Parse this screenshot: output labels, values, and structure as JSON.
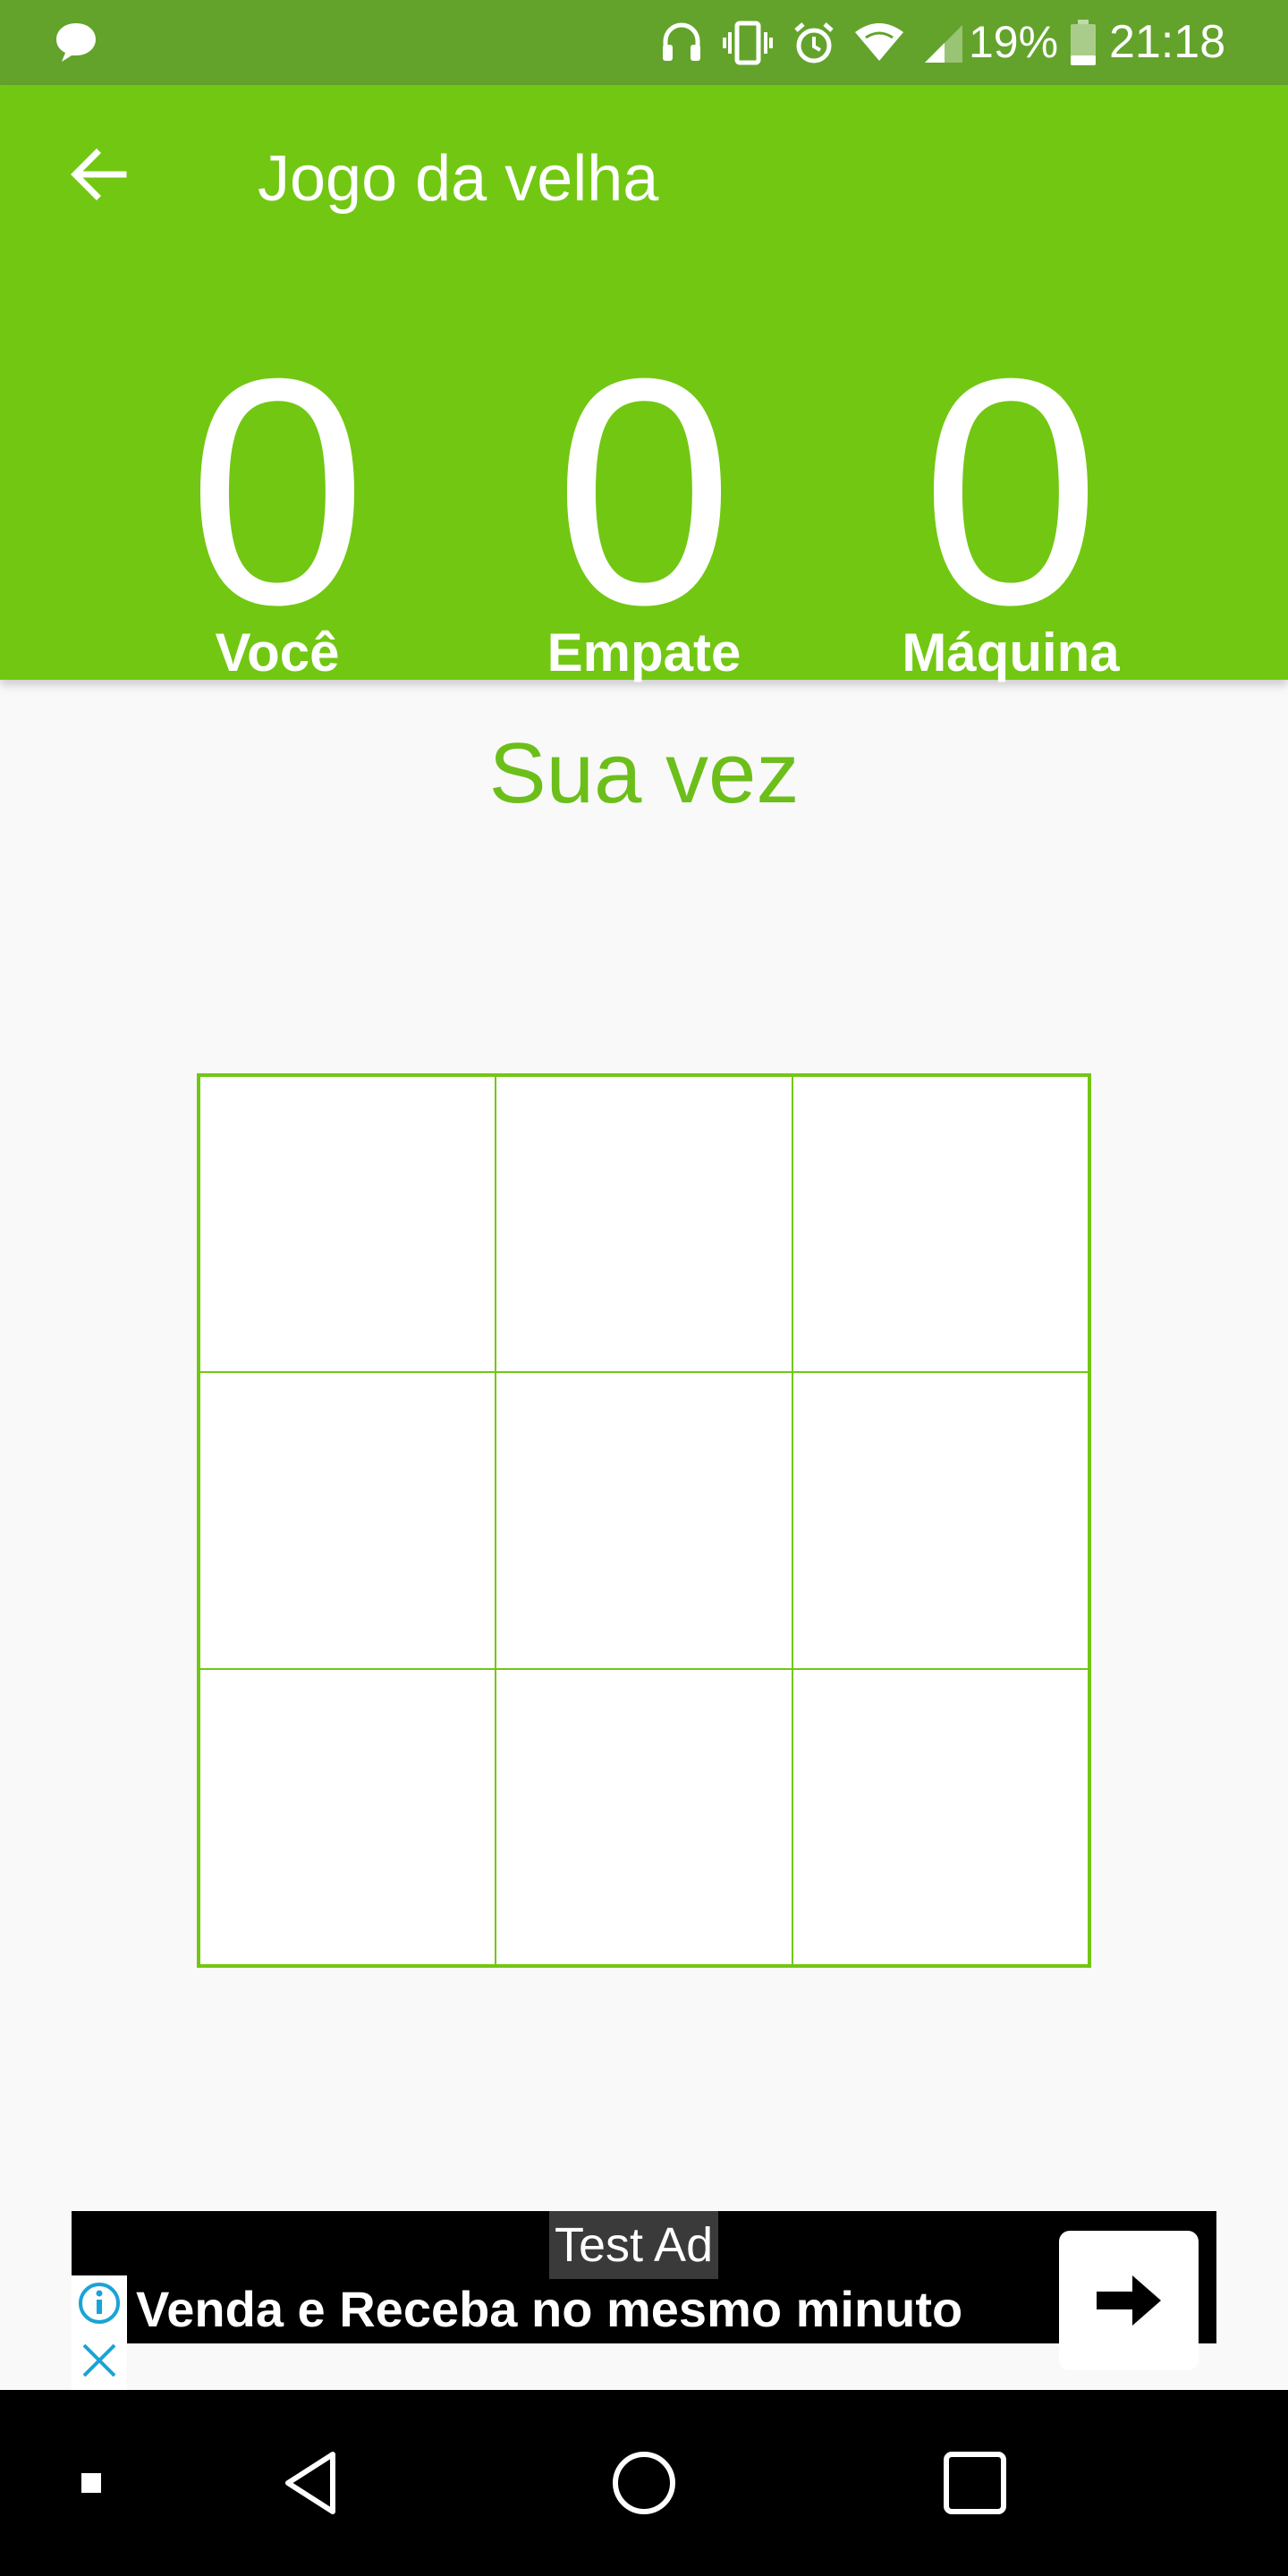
{
  "status_bar": {
    "battery_percent": "19%",
    "time": "21:18",
    "icons": [
      "chat-bubble-icon",
      "headset-icon",
      "vibrate-icon",
      "alarm-icon",
      "wifi-icon",
      "signal-icon",
      "battery-icon"
    ]
  },
  "header": {
    "title": "Jogo da velha",
    "back_icon": "arrow-left-icon"
  },
  "scoreboard": {
    "you": {
      "value": "0",
      "label": "Você"
    },
    "draw": {
      "value": "0",
      "label": "Empate"
    },
    "machine": {
      "value": "0",
      "label": "Máquina"
    }
  },
  "turn_text": "Sua vez",
  "board": {
    "cells": [
      "",
      "",
      "",
      "",
      "",
      "",
      "",
      "",
      ""
    ]
  },
  "ad": {
    "badge": "Test Ad",
    "headline": "Venda e Receba no mesmo minuto",
    "icons": [
      "info-icon",
      "close-icon",
      "arrow-right-icon"
    ]
  },
  "navigation": {
    "icons": [
      "square-dot-icon",
      "back-triangle-icon",
      "home-circle-icon",
      "recents-square-icon"
    ]
  },
  "colors": {
    "status_bar": "#63a32c",
    "primary": "#72c713",
    "turn_text": "#6cbf1a",
    "background": "#f9f9f9"
  }
}
